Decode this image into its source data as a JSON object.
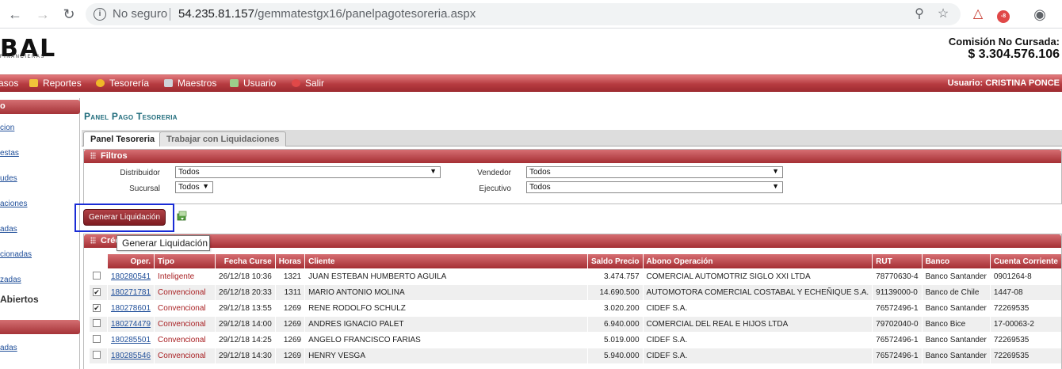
{
  "browser": {
    "security_label": "No seguro",
    "url_host": "54.235.81.157",
    "url_path": "/gemmatestgx16/panelpagotesoreria.aspx"
  },
  "header": {
    "logo_text": "BAL",
    "logo_sub": "FINANCIERAS",
    "comision_label": "Comisión No Cursada:",
    "comision_value": "$ 3.304.576.106"
  },
  "menu": {
    "items": [
      {
        "label": "asos",
        "icon_color": "#e9c45a"
      },
      {
        "label": "Reportes",
        "icon_color": "#f2c43a"
      },
      {
        "label": "Tesorería",
        "icon_color": "#f0b828"
      },
      {
        "label": "Maestros",
        "icon_color": "#cfd3d8"
      },
      {
        "label": "Usuario",
        "icon_color": "#9ccf8a"
      },
      {
        "label": "Salir",
        "icon_color": "#e04848"
      }
    ],
    "usuario_label": "Usuario:",
    "usuario_name": "CRISTINA PONCE"
  },
  "sidebar": {
    "head1": "o",
    "links": [
      "cion",
      "estas",
      "udes",
      "aciones",
      "adas",
      "cionadas",
      "zadas"
    ],
    "abiertos": "Abiertos",
    "last_link": "adas"
  },
  "main": {
    "title": "Panel Pago Tesoreria",
    "tabs": [
      {
        "label": "Panel Tesoreria",
        "active": true
      },
      {
        "label": "Trabajar con Liquidaciones",
        "active": false
      }
    ],
    "filtros": {
      "title": "Filtros",
      "distribuidor_label": "Distribuidor",
      "distribuidor_value": "Todos",
      "sucursal_label": "Sucursal",
      "sucursal_value": "Todos",
      "vendedor_label": "Vendedor",
      "vendedor_value": "Todos",
      "ejecutivo_label": "Ejecutivo",
      "ejecutivo_value": "Todos"
    },
    "generar_button": "Generar Liquidación",
    "tooltip": "Generar Liquidación",
    "creditos_title": "Créd"
  },
  "table": {
    "columns": [
      "Oper.",
      "Tipo",
      "Fecha Curse",
      "Horas",
      "Cliente",
      "Saldo Precio",
      "Abono Operación",
      "RUT",
      "Banco",
      "Cuenta Corriente"
    ],
    "rows": [
      {
        "checked": false,
        "oper": "180280541",
        "tipo": "Inteligente",
        "fecha": "26/12/18 10:36",
        "horas": "1321",
        "cliente": "JUAN ESTEBAN HUMBERTO AGUILA",
        "saldo": "3.474.757",
        "abono": "COMERCIAL AUTOMOTRIZ SIGLO XXI LTDA",
        "rut": "78770630-4",
        "banco": "Banco Santander",
        "cuenta": "0901264-8"
      },
      {
        "checked": true,
        "oper": "180271781",
        "tipo": "Convencional",
        "fecha": "26/12/18 20:33",
        "horas": "1311",
        "cliente": "MARIO ANTONIO MOLINA",
        "saldo": "14.690.500",
        "abono": "AUTOMOTORA COMERCIAL COSTABAL Y ECHEÑIQUE S.A.",
        "rut": "91139000-0",
        "banco": "Banco de Chile",
        "cuenta": "1447-08"
      },
      {
        "checked": true,
        "oper": "180278601",
        "tipo": "Convencional",
        "fecha": "29/12/18 13:55",
        "horas": "1269",
        "cliente": "RENE RODOLFO SCHULZ",
        "saldo": "3.020.200",
        "abono": "CIDEF S.A.",
        "rut": "76572496-1",
        "banco": "Banco Santander",
        "cuenta": "72269535"
      },
      {
        "checked": false,
        "oper": "180274479",
        "tipo": "Convencional",
        "fecha": "29/12/18 14:00",
        "horas": "1269",
        "cliente": "ANDRES IGNACIO PALET",
        "saldo": "6.940.000",
        "abono": "COMERCIAL DEL REAL E HIJOS LTDA",
        "rut": "79702040-0",
        "banco": "Banco Bice",
        "cuenta": "17-00063-2"
      },
      {
        "checked": false,
        "oper": "180285501",
        "tipo": "Convencional",
        "fecha": "29/12/18 14:25",
        "horas": "1269",
        "cliente": "ANGELO FRANCISCO FARIAS",
        "saldo": "5.019.000",
        "abono": "CIDEF S.A.",
        "rut": "76572496-1",
        "banco": "Banco Santander",
        "cuenta": "72269535"
      },
      {
        "checked": false,
        "oper": "180285546",
        "tipo": "Convencional",
        "fecha": "29/12/18 14:30",
        "horas": "1269",
        "cliente": "HENRY VESGA",
        "saldo": "5.940.000",
        "abono": "CIDEF S.A.",
        "rut": "76572496-1",
        "banco": "Banco Santander",
        "cuenta": "72269535"
      }
    ]
  }
}
